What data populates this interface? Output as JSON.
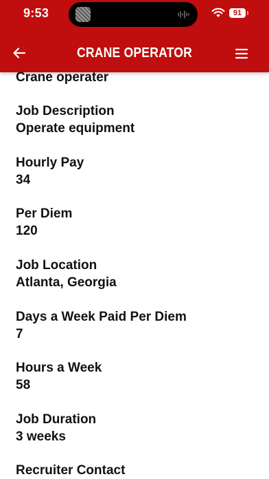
{
  "status_bar": {
    "time": "9:53",
    "battery": "91"
  },
  "header": {
    "title": "CRANE OPERATOR",
    "background_color": "#c00d0d"
  },
  "icons": {
    "back": "arrow-left-icon",
    "menu": "hamburger-menu-icon",
    "wifi": "wifi-icon"
  },
  "job": {
    "title_value": "Crane operater",
    "fields": [
      {
        "label": "Job Description",
        "value": "Operate equipment"
      },
      {
        "label": "Hourly Pay",
        "value": "34"
      },
      {
        "label": "Per Diem",
        "value": "120"
      },
      {
        "label": "Job Location",
        "value": "Atlanta, Georgia"
      },
      {
        "label": "Days a Week Paid Per Diem",
        "value": "7"
      },
      {
        "label": "Hours a Week",
        "value": "58"
      },
      {
        "label": "Job Duration",
        "value": "3 weeks"
      },
      {
        "label": "Recruiter Contact",
        "value": ""
      }
    ]
  }
}
